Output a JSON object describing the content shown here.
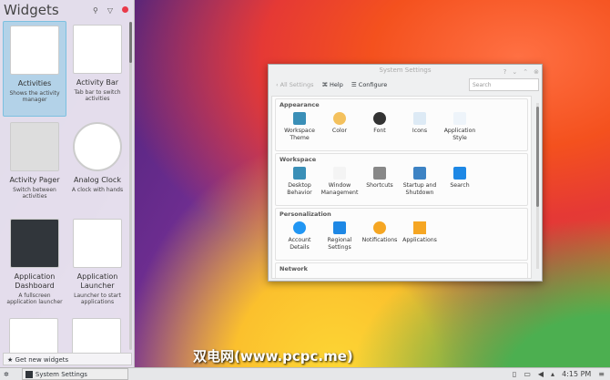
{
  "panel": {
    "title": "Widgets",
    "get_new": "Get new widgets",
    "widgets": [
      {
        "name": "Activities",
        "desc": "Shows the activity manager"
      },
      {
        "name": "Activity Bar",
        "desc": "Tab bar to switch activities"
      },
      {
        "name": "Activity Pager",
        "desc": "Switch between activities"
      },
      {
        "name": "Analog Clock",
        "desc": "A clock with hands"
      },
      {
        "name": "Application Dashboard",
        "desc": "A fullscreen application launcher"
      },
      {
        "name": "Application Launcher",
        "desc": "Launcher to start applications"
      }
    ]
  },
  "taskbar": {
    "task": "System Settings",
    "time": "4:15 PM"
  },
  "window": {
    "title": "System Settings",
    "back": "All Settings",
    "help": "Help",
    "configure": "Configure",
    "search_placeholder": "Search",
    "sections": [
      {
        "title": "Appearance",
        "items": [
          "Workspace Theme",
          "Color",
          "Font",
          "Icons",
          "Application Style"
        ]
      },
      {
        "title": "Workspace",
        "items": [
          "Desktop Behavior",
          "Window Management",
          "Shortcuts",
          "Startup and Shutdown",
          "Search"
        ]
      },
      {
        "title": "Personalization",
        "items": [
          "Account Details",
          "Regional Settings",
          "Notifications",
          "Applications"
        ]
      },
      {
        "title": "Network",
        "items": []
      }
    ]
  },
  "watermark": "双电网(www.pcpc.me)",
  "colors": {
    "accent": "#3daee9",
    "selected": "#8cc8e6"
  }
}
